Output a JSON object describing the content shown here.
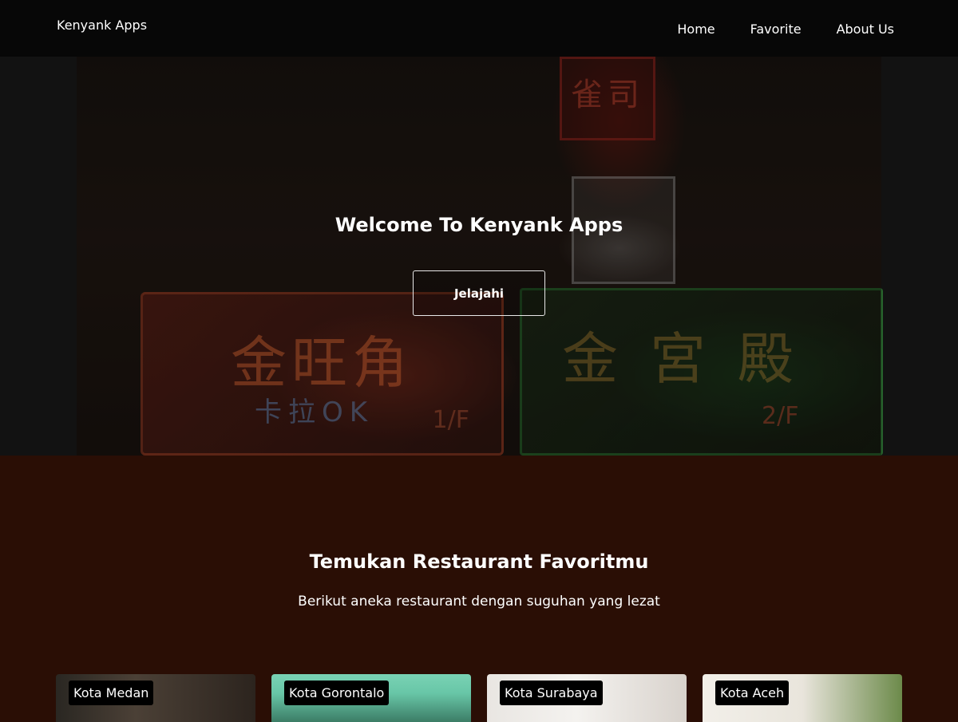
{
  "header": {
    "brand": "Kenyank Apps",
    "nav": [
      "Home",
      "Favorite",
      "About Us"
    ]
  },
  "hero": {
    "title": "Welcome To Kenyank Apps",
    "button_label": "Jelajahi",
    "signs": {
      "left_big": "金旺角",
      "left_mid": "卡拉OK",
      "left_floor": "1/F",
      "right_big": "金宮殿",
      "right_floor": "2/F",
      "top": "雀司"
    }
  },
  "section": {
    "title": "Temukan Restaurant Favoritmu",
    "subtitle": "Berikut aneka restaurant dengan suguhan yang lezat"
  },
  "cards": [
    {
      "city": "Kota Medan"
    },
    {
      "city": "Kota Gorontalo"
    },
    {
      "city": "Kota Surabaya"
    },
    {
      "city": "Kota Aceh"
    }
  ],
  "colors": {
    "header_bg": "#070707",
    "content_bg": "#2a0e05",
    "accent_line": "#d7a21c"
  }
}
